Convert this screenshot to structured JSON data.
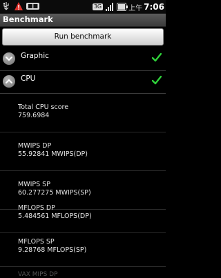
{
  "status_bar": {
    "time": "7:06",
    "ampm": "上午",
    "network_tag": "3G",
    "icons": [
      "usb-icon",
      "warning-icon",
      "battery-small-icon",
      "network-3g-icon",
      "signal-icon",
      "battery-icon"
    ]
  },
  "app": {
    "title": "Benchmark"
  },
  "run_button": {
    "label": "Run benchmark"
  },
  "groups": [
    {
      "label": "Graphic",
      "expanded": false,
      "done": true
    },
    {
      "label": "CPU",
      "expanded": true,
      "done": true
    }
  ],
  "results": [
    {
      "name": "Total CPU score",
      "value": "759.6984"
    },
    {
      "name": "MWIPS DP",
      "value": "55.92841 MWIPS(DP)"
    },
    {
      "name": "MWIPS SP",
      "value": "60.277275 MWIPS(SP)"
    },
    {
      "name": "MFLOPS DP",
      "value": "5.484561 MFLOPS(DP)"
    },
    {
      "name": "MFLOPS SP",
      "value": "9.28768 MFLOPS(SP)"
    }
  ],
  "partial_next": "VAX MIPS DP",
  "colors": {
    "check": "#2fd23a",
    "title_bg": "#4a4a4a",
    "background": "#000000"
  }
}
